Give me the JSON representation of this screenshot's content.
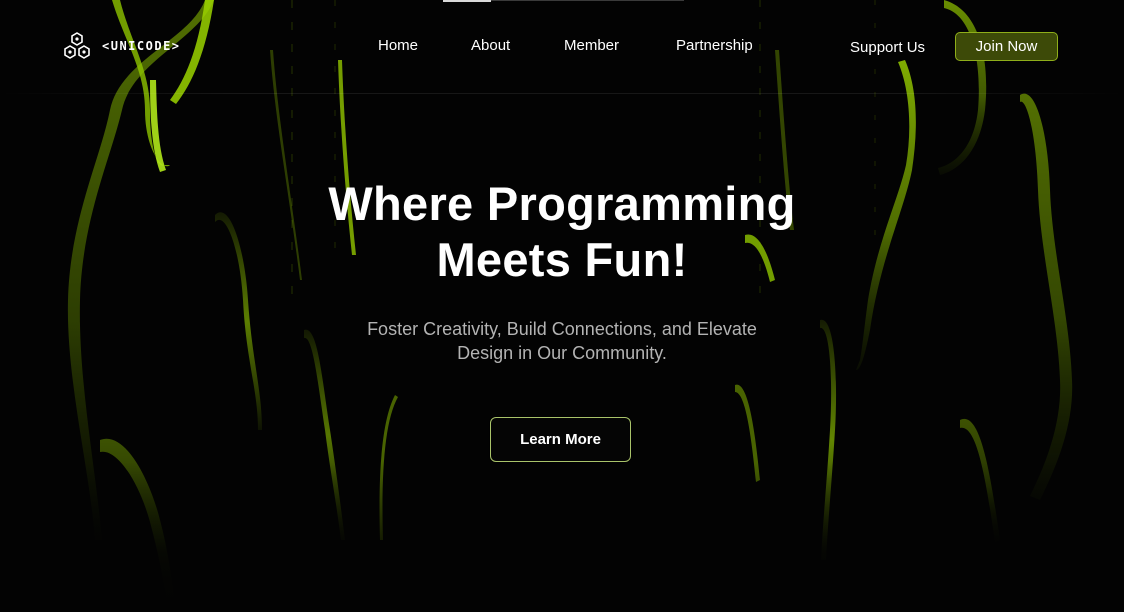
{
  "brand": {
    "logo_text": "<UNICODE>",
    "logo_icon": "hexagon-cluster-icon"
  },
  "nav": {
    "items": [
      {
        "label": "Home"
      },
      {
        "label": "About"
      },
      {
        "label": "Member"
      },
      {
        "label": "Partnership"
      }
    ],
    "support_label": "Support Us",
    "join_label": "Join Now"
  },
  "hero": {
    "title_line1": "Where Programming",
    "title_line2": "Meets Fun!",
    "subtitle_line1": "Foster Creativity, Build Connections, and Elevate",
    "subtitle_line2": "Design in Our Community.",
    "cta_label": "Learn More"
  },
  "colors": {
    "background": "#030303",
    "accent": "#8fc400",
    "join_button_bg": "#3d4a08",
    "text": "#ffffff",
    "subtitle_text": "#b3b3b3"
  }
}
